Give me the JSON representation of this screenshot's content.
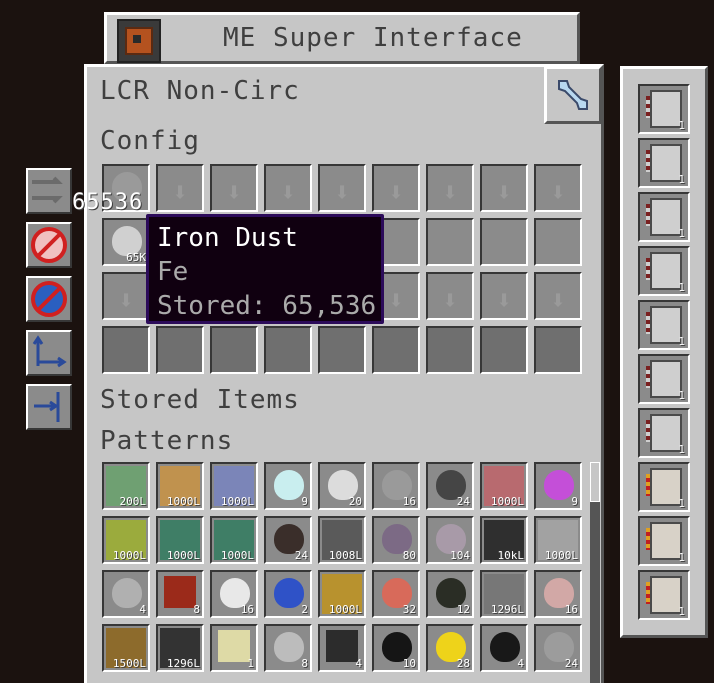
{
  "window": {
    "title": "ME Super Interface",
    "name": "LCR Non-Circ"
  },
  "sections": {
    "config": "Config",
    "stored": "Stored Items",
    "patterns": "Patterns"
  },
  "side_count_overlay": "65536",
  "tooltip": {
    "item": "Iron Dust",
    "formula": "Fe",
    "stored": "Stored: 65,536"
  },
  "config_slots": [
    {
      "row": 0,
      "col": 0,
      "icon": "stone-dust-icon",
      "amount": ""
    },
    {
      "row": 1,
      "col": 0,
      "icon": "iron-dust-icon",
      "amount": "65K"
    }
  ],
  "pattern_grid": [
    [
      {
        "icon": "fluid-green",
        "amount": "200L",
        "color": "#6fa072"
      },
      {
        "icon": "fluid-orange",
        "amount": "1000L",
        "color": "#c0924e"
      },
      {
        "icon": "fluid-blue",
        "amount": "1000L",
        "color": "#7b85b8"
      },
      {
        "icon": "dust-cyan",
        "amount": "9",
        "color": "#c9eeef"
      },
      {
        "icon": "dust-white",
        "amount": "20",
        "color": "#dcdcdc"
      },
      {
        "icon": "dust-gray",
        "amount": "16",
        "color": "#9a9a9a"
      },
      {
        "icon": "dust-dark",
        "amount": "24",
        "color": "#454545"
      },
      {
        "icon": "fluid-red",
        "amount": "1000L",
        "color": "#b86a6f"
      },
      {
        "icon": "dust-purple",
        "amount": "9",
        "color": "#c44fd8"
      }
    ],
    [
      {
        "icon": "fluid-olive",
        "amount": "1000L",
        "color": "#9bab3d"
      },
      {
        "icon": "fluid-teal",
        "amount": "1000L",
        "color": "#3f7e66"
      },
      {
        "icon": "fluid-teal",
        "amount": "1000L",
        "color": "#3f7e66"
      },
      {
        "icon": "dust-brown",
        "amount": "24",
        "color": "#3a2e2a"
      },
      {
        "icon": "fluid-darkgray",
        "amount": "1008L",
        "color": "#5a5a5a"
      },
      {
        "icon": "dust-mauve",
        "amount": "80",
        "color": "#7c6a85"
      },
      {
        "icon": "dust-lilac",
        "amount": "104",
        "color": "#a89aa8"
      },
      {
        "icon": "fluid-black",
        "amount": "10kL",
        "color": "#2f2f2f"
      },
      {
        "icon": "fluid-silver",
        "amount": "1000L",
        "color": "#a2a2a2"
      }
    ],
    [
      {
        "icon": "dust-light",
        "amount": "4",
        "color": "#b0b0b0"
      },
      {
        "icon": "tnt-icon",
        "amount": "8",
        "color": "#9b2a1a"
      },
      {
        "icon": "dust-white",
        "amount": "16",
        "color": "#e8e8e8"
      },
      {
        "icon": "dust-blue",
        "amount": "2",
        "color": "#2f52c7"
      },
      {
        "icon": "fluid-gold",
        "amount": "1000L",
        "color": "#b8922e"
      },
      {
        "icon": "dust-salmon",
        "amount": "32",
        "color": "#d86a5a"
      },
      {
        "icon": "dust-black",
        "amount": "12",
        "color": "#2a2d25"
      },
      {
        "icon": "fluid-gray",
        "amount": "1296L",
        "color": "#777777"
      },
      {
        "icon": "dust-pink",
        "amount": "16",
        "color": "#d2a8a6"
      }
    ],
    [
      {
        "icon": "fluid-brown",
        "amount": "1500L",
        "color": "#8d6b2c"
      },
      {
        "icon": "fluid-charcoal",
        "amount": "1296L",
        "color": "#333333"
      },
      {
        "icon": "endstone-icon",
        "amount": "1",
        "color": "#dedaa6"
      },
      {
        "icon": "dust-silver",
        "amount": "8",
        "color": "#bcbcbc"
      },
      {
        "icon": "circuit-icon",
        "amount": "4",
        "color": "#2c2c2c"
      },
      {
        "icon": "cannon-icon",
        "amount": "10",
        "color": "#151515"
      },
      {
        "icon": "dust-yellow",
        "amount": "28",
        "color": "#eed31a"
      },
      {
        "icon": "dust-black",
        "amount": "4",
        "color": "#181818"
      },
      {
        "icon": "dust-gray",
        "amount": "24",
        "color": "#9c9c9c"
      }
    ]
  ],
  "right_patterns": [
    {
      "icon": "encoded-pattern-icon",
      "amount": "1"
    },
    {
      "icon": "encoded-pattern-icon",
      "amount": "1"
    },
    {
      "icon": "encoded-pattern-icon",
      "amount": "1"
    },
    {
      "icon": "encoded-pattern-icon",
      "amount": "1"
    },
    {
      "icon": "encoded-pattern-icon",
      "amount": "1"
    },
    {
      "icon": "encoded-pattern-icon",
      "amount": "1"
    },
    {
      "icon": "encoded-pattern-icon",
      "amount": "1"
    },
    {
      "icon": "crafting-pattern-icon",
      "amount": "1"
    },
    {
      "icon": "crafting-pattern-icon",
      "amount": "1"
    },
    {
      "icon": "crafting-pattern-icon",
      "amount": "1"
    }
  ],
  "colors": {
    "tooltip_title": "#ffffff",
    "tooltip_sub": "#aaaaaa"
  }
}
